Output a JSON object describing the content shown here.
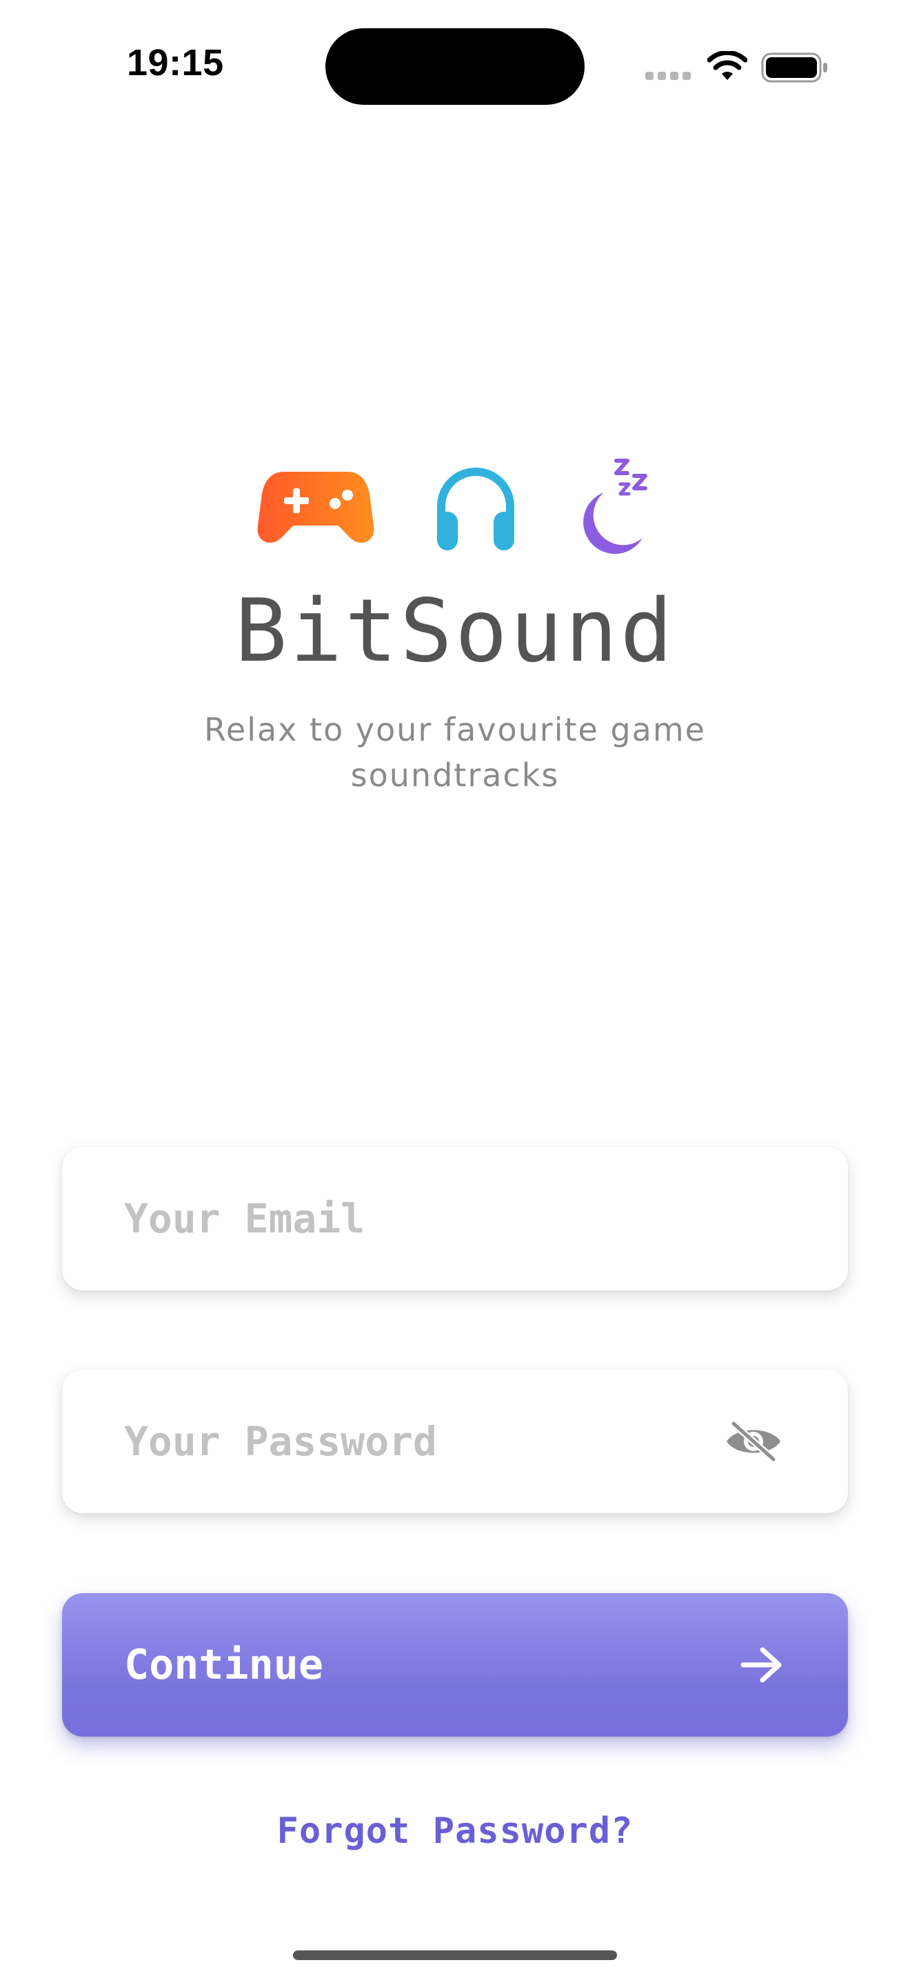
{
  "status_bar": {
    "time": "19:15"
  },
  "logo": {
    "icons": [
      "gamepad-icon",
      "headphones-icon",
      "moon-sleep-icon"
    ],
    "title": "BitSound",
    "tagline": "Relax to your favourite game soundtracks"
  },
  "form": {
    "email": {
      "value": "",
      "placeholder": "Your Email"
    },
    "password": {
      "value": "",
      "placeholder": "Your Password",
      "visibility_icon": "eye-slash-icon"
    },
    "continue_label": "Continue",
    "continue_icon": "arrow-right-icon",
    "forgot_label": "Forgot Password?"
  },
  "colors": {
    "accent": "#7a74dd",
    "link": "#6a5fd4",
    "gamepad": "#ff6a2c",
    "headphones": "#31b2dd",
    "moon": "#8c5ce0"
  }
}
